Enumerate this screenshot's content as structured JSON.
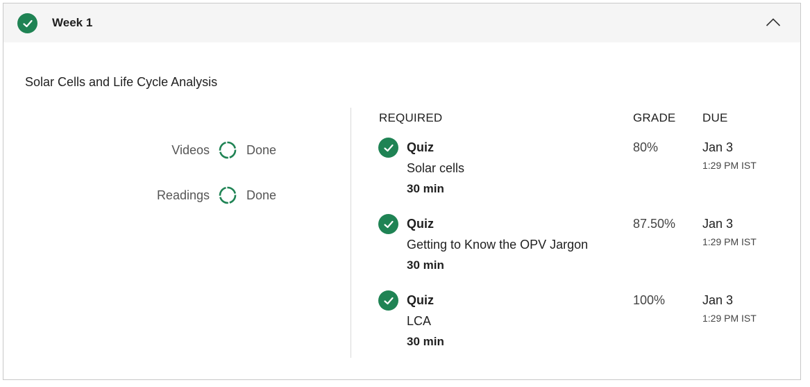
{
  "header": {
    "week_title": "Week 1",
    "completed": true,
    "accent_color": "#1f8354"
  },
  "module": {
    "title": "Solar Cells and Life Cycle Analysis"
  },
  "summary": [
    {
      "label": "Videos",
      "status": "Done",
      "icon": "progress-ring-icon"
    },
    {
      "label": "Readings",
      "status": "Done",
      "icon": "progress-ring-icon"
    }
  ],
  "columns": {
    "required": "REQUIRED",
    "grade": "GRADE",
    "due": "DUE"
  },
  "items": [
    {
      "type": "Quiz",
      "name": "Solar cells",
      "duration": "30 min",
      "grade": "80%",
      "due_date": "Jan 3",
      "due_time": "1:29 PM IST",
      "completed": true
    },
    {
      "type": "Quiz",
      "name": "Getting to Know the OPV Jargon",
      "duration": "30 min",
      "grade": "87.50%",
      "due_date": "Jan 3",
      "due_time": "1:29 PM IST",
      "completed": true
    },
    {
      "type": "Quiz",
      "name": "LCA",
      "duration": "30 min",
      "grade": "100%",
      "due_date": "Jan 3",
      "due_time": "1:29 PM IST",
      "completed": true
    }
  ]
}
